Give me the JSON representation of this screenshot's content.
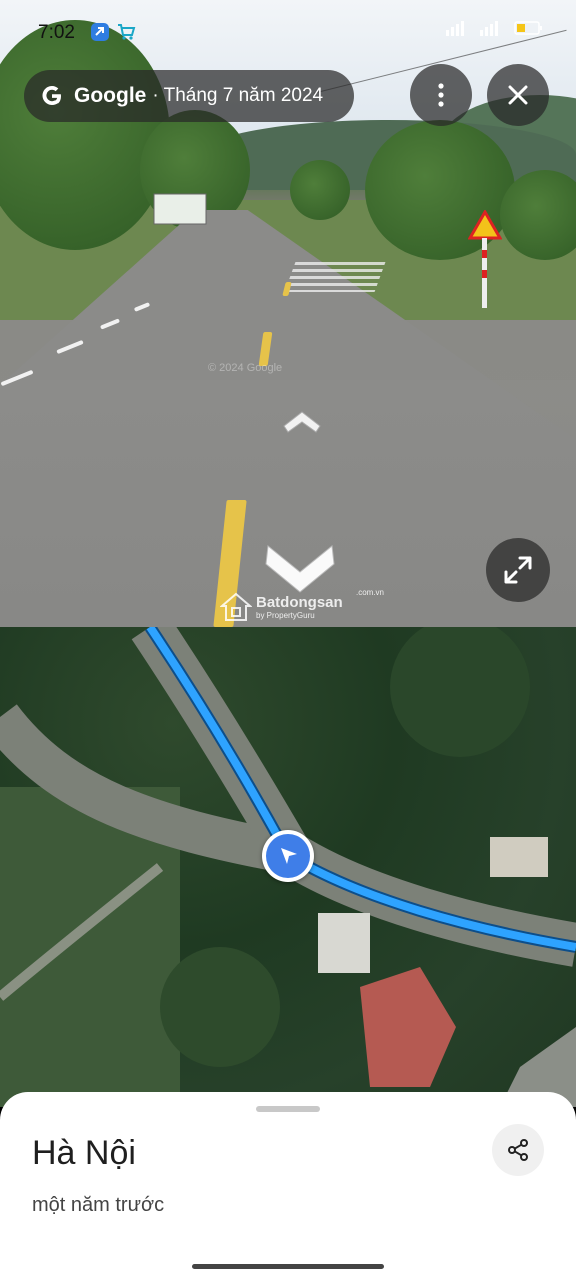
{
  "status_bar": {
    "time": "7:02"
  },
  "header": {
    "brand": "Google",
    "date_label": "· Tháng 7 năm 2024"
  },
  "streetview": {
    "copyright": "© 2024 Google",
    "watermark": {
      "brand": "Batdongsan",
      "sub": "by PropertyGuru",
      "domain": ".com.vn"
    }
  },
  "place": {
    "title": "Hà Nội",
    "subtitle": "một năm trước"
  },
  "colors": {
    "route": "#2ea3ff",
    "marker": "#3f7ee8"
  }
}
